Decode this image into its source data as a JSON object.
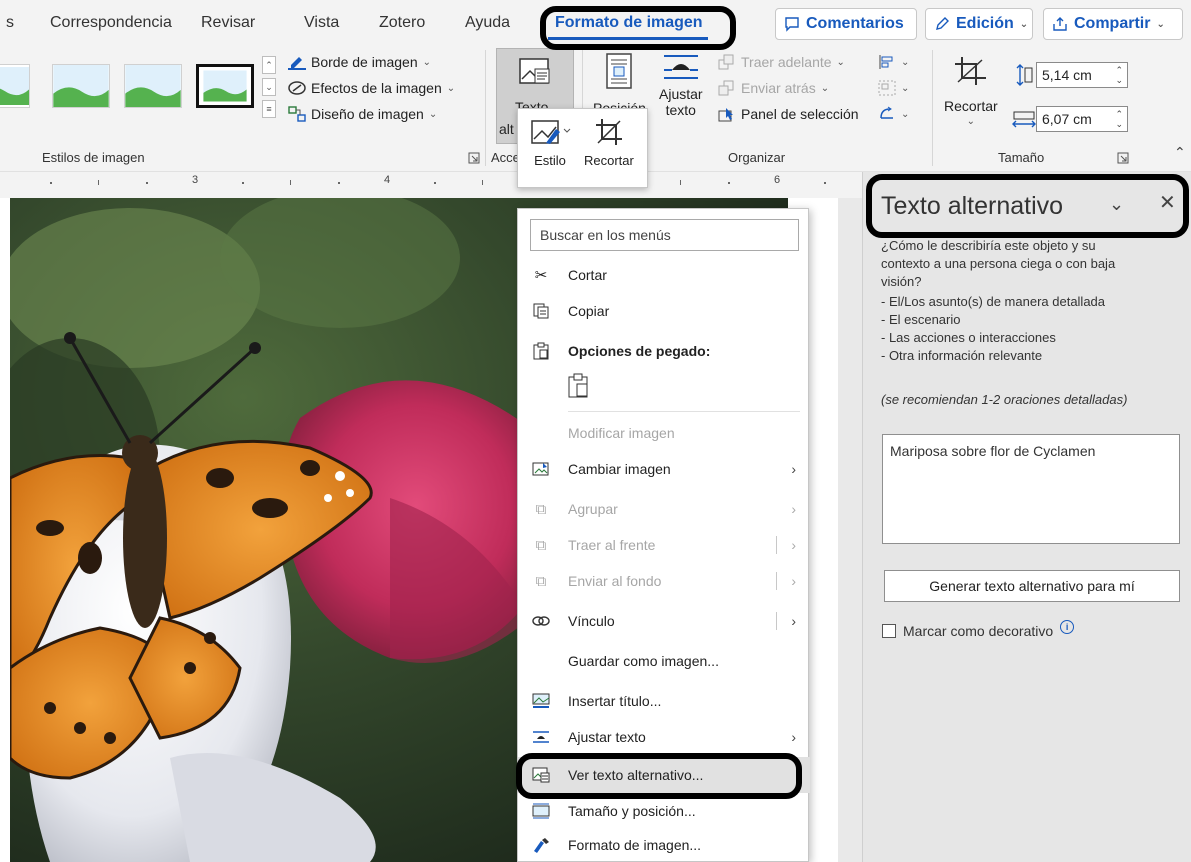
{
  "tabs": [
    {
      "label": "s"
    },
    {
      "label": "Correspondencia"
    },
    {
      "label": "Revisar"
    },
    {
      "label": "Vista"
    },
    {
      "label": "Zotero"
    },
    {
      "label": "Ayuda"
    },
    {
      "label": "Formato de imagen"
    }
  ],
  "header_buttons": {
    "comments": "Comentarios",
    "editing": "Edición",
    "share": "Compartir"
  },
  "ribbon": {
    "styles_group": "Estilos de imagen",
    "border": "Borde de imagen",
    "effects": "Efectos de la imagen",
    "layout": "Diseño de imagen",
    "alt_text_btn_line1": "Texto",
    "alt_text_btn_line2": "alt",
    "accessibility_group": "Acce",
    "position": "Posición",
    "wrap_line1": "Ajustar",
    "wrap_line2": "texto",
    "bring_forward": "Traer adelante",
    "send_backward": "Enviar atrás",
    "selection_pane": "Panel de selección",
    "arrange_group": "Organizar",
    "crop": "Recortar",
    "height": "5,14 cm",
    "width": "6,07 cm",
    "size_group": "Tamaño"
  },
  "mini_toolbar": {
    "style": "Estilo",
    "crop": "Recortar"
  },
  "ruler": {
    "marks": [
      "3",
      "4",
      "6"
    ]
  },
  "context_menu": {
    "search_placeholder": "Buscar en los menús",
    "items": [
      {
        "label": "Cortar",
        "icon": "scissors-icon"
      },
      {
        "label": "Copiar",
        "icon": "copy-icon"
      },
      {
        "label": "Opciones de pegado:",
        "icon": "paste-icon"
      },
      {
        "label": "Modificar imagen"
      },
      {
        "label": "Cambiar imagen",
        "icon": "change-picture-icon"
      },
      {
        "label": "Agrupar",
        "icon": "group-icon"
      },
      {
        "label": "Traer al frente",
        "icon": "bring-front-icon"
      },
      {
        "label": "Enviar al fondo",
        "icon": "send-back-icon"
      },
      {
        "label": "Vínculo",
        "icon": "link-icon"
      },
      {
        "label": "Guardar como imagen..."
      },
      {
        "label": "Insertar título...",
        "icon": "caption-icon"
      },
      {
        "label": "Ajustar texto",
        "icon": "wrap-text-icon"
      },
      {
        "label": "Ver texto alternativo...",
        "icon": "alt-text-icon"
      },
      {
        "label": "Tamaño y posición...",
        "icon": "size-position-icon"
      },
      {
        "label": "Formato de imagen...",
        "icon": "format-picture-icon"
      }
    ]
  },
  "alt_pane": {
    "title": "Texto alternativo",
    "instructions": [
      "¿Cómo le describiría este objeto y su",
      "contexto a una persona ciega o con baja",
      "visión?",
      "- El/Los asunto(s) de manera detallada",
      "- El escenario",
      "- Las acciones o interacciones",
      "- Otra información relevante"
    ],
    "recommendation": "(se recomiendan 1-2 oraciones detalladas)",
    "alt_text_value": "Mariposa sobre flor de Cyclamen",
    "generate_button": "Generar texto alternativo para mí",
    "decorative_label": "Marcar como decorativo"
  },
  "colors": {
    "accent": "#185abd",
    "highlight_border": "#000000",
    "pane_bg": "#e6e6e6"
  }
}
